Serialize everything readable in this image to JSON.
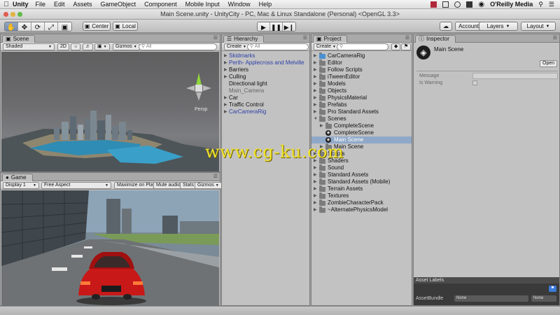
{
  "menubar": {
    "app_name": "Unity",
    "items": [
      "File",
      "Edit",
      "Assets",
      "GameObject",
      "Component",
      "Mobile Input",
      "Window",
      "Help"
    ],
    "right_text": "O'Reilly Media"
  },
  "window_title": "Main Scene.unity - UnityCity - PC, Mac & Linux Standalone (Personal) <OpenGL 3.3>",
  "toolbar": {
    "pivot_label": "Center",
    "space_label": "Local",
    "account_label": "Account",
    "layers_label": "Layers",
    "layout_label": "Layout"
  },
  "scene": {
    "tab_label": "Scene",
    "shading_mode": "Shaded",
    "mode_2d": "2D",
    "gizmos_label": "Gizmos",
    "search_placeholder": "All",
    "persp_label": "Persp"
  },
  "game": {
    "tab_label": "Game",
    "display_label": "Display 1",
    "aspect_label": "Free Aspect",
    "maximize_label": "Maximize on Play",
    "mute_label": "Mute audio",
    "stats_label": "Stats",
    "gizmos_label": "Gizmos"
  },
  "hierarchy": {
    "tab_label": "Hierarchy",
    "create_label": "Create",
    "search_placeholder": "All",
    "items": [
      {
        "label": "Skidmarks",
        "arrow": true,
        "color": "blue"
      },
      {
        "label": "Perth- Applecross and Melville",
        "arrow": true,
        "color": "blue"
      },
      {
        "label": "Barriers",
        "arrow": true,
        "color": "black"
      },
      {
        "label": "Culling",
        "arrow": true,
        "color": "black"
      },
      {
        "label": "Directional light",
        "arrow": false,
        "color": "black"
      },
      {
        "label": "Main_Camera",
        "arrow": false,
        "color": "gray"
      },
      {
        "label": "Car",
        "arrow": true,
        "color": "black"
      },
      {
        "label": "Traffic Control",
        "arrow": true,
        "color": "black"
      },
      {
        "label": "CarCameraRig",
        "arrow": true,
        "color": "blue"
      }
    ]
  },
  "project": {
    "tab_label": "Project",
    "create_label": "Create",
    "items": [
      {
        "label": "CarCameraRig",
        "level": 0,
        "kind": "prefab",
        "arrow": "right"
      },
      {
        "label": "Editor",
        "level": 0,
        "kind": "folder",
        "arrow": "right"
      },
      {
        "label": "Follow Scripts",
        "level": 0,
        "kind": "folder",
        "arrow": "right"
      },
      {
        "label": "iTweenEditor",
        "level": 0,
        "kind": "folder",
        "arrow": "right"
      },
      {
        "label": "Models",
        "level": 0,
        "kind": "folder",
        "arrow": "right"
      },
      {
        "label": "Objects",
        "level": 0,
        "kind": "folder",
        "arrow": "right"
      },
      {
        "label": "PhysicsMaterial",
        "level": 0,
        "kind": "folder",
        "arrow": "right"
      },
      {
        "label": "Prefabs",
        "level": 0,
        "kind": "folder",
        "arrow": "right"
      },
      {
        "label": "Pro Standard Assets",
        "level": 0,
        "kind": "folder",
        "arrow": "right"
      },
      {
        "label": "Scenes",
        "level": 0,
        "kind": "folder",
        "arrow": "down"
      },
      {
        "label": "CompleteScene",
        "level": 1,
        "kind": "folder",
        "arrow": "right"
      },
      {
        "label": "CompleteScene",
        "level": 1,
        "kind": "scene",
        "arrow": "none"
      },
      {
        "label": "Main Scene",
        "level": 1,
        "kind": "scene",
        "arrow": "none",
        "selected": true
      },
      {
        "label": "Main Scene",
        "level": 1,
        "kind": "folder",
        "arrow": "right"
      },
      {
        "label": "Scripts",
        "level": 0,
        "kind": "folder",
        "arrow": "right"
      },
      {
        "label": "Shaders",
        "level": 0,
        "kind": "folder",
        "arrow": "right"
      },
      {
        "label": "Sound",
        "level": 0,
        "kind": "folder",
        "arrow": "right"
      },
      {
        "label": "Standard Assets",
        "level": 0,
        "kind": "folder",
        "arrow": "right"
      },
      {
        "label": "Standard Assets (Mobile)",
        "level": 0,
        "kind": "folder",
        "arrow": "right"
      },
      {
        "label": "Terrain Assets",
        "level": 0,
        "kind": "folder",
        "arrow": "right"
      },
      {
        "label": "Textures",
        "level": 0,
        "kind": "folder",
        "arrow": "right"
      },
      {
        "label": "ZombieCharacterPack",
        "level": 0,
        "kind": "folder",
        "arrow": "right"
      },
      {
        "label": "~AlternatePhysicsModel",
        "level": 0,
        "kind": "folder",
        "arrow": "right"
      }
    ]
  },
  "inspector": {
    "tab_label": "Inspector",
    "object_name": "Main Scene",
    "open_label": "Open",
    "message_label": "Message",
    "warning_label": "Is Warning",
    "asset_labels_title": "Asset Labels",
    "assetbundle_label": "AssetBundle",
    "assetbundle_value": "None",
    "variant_value": "None"
  },
  "watermark_text": "www.cg-ku.com",
  "colors": {
    "watermark": "#f2e32c",
    "selection": "#8fa8c8",
    "prefab_blue": "#2b3fa6"
  }
}
